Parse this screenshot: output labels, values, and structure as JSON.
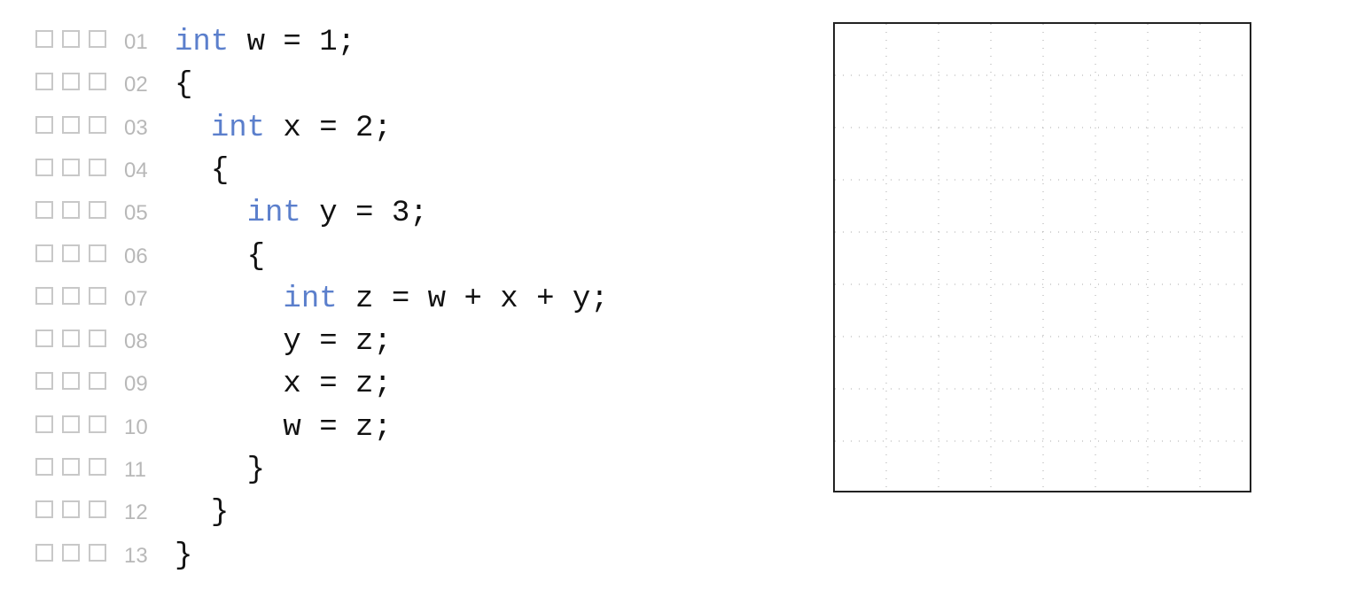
{
  "code": {
    "lines": [
      {
        "number": "01",
        "indent": "",
        "keyword": "int",
        "text": " w = 1;"
      },
      {
        "number": "02",
        "indent": "",
        "keyword": "",
        "text": "{"
      },
      {
        "number": "03",
        "indent": "  ",
        "keyword": "int",
        "text": " x = 2;"
      },
      {
        "number": "04",
        "indent": "  ",
        "keyword": "",
        "text": "{"
      },
      {
        "number": "05",
        "indent": "    ",
        "keyword": "int",
        "text": " y = 3;"
      },
      {
        "number": "06",
        "indent": "    ",
        "keyword": "",
        "text": "{"
      },
      {
        "number": "07",
        "indent": "      ",
        "keyword": "int",
        "text": " z = w + x + y;"
      },
      {
        "number": "08",
        "indent": "      ",
        "keyword": "",
        "text": "y = z;"
      },
      {
        "number": "09",
        "indent": "      ",
        "keyword": "",
        "text": "x = z;"
      },
      {
        "number": "10",
        "indent": "      ",
        "keyword": "",
        "text": "w = z;"
      },
      {
        "number": "11",
        "indent": "    ",
        "keyword": "",
        "text": "}"
      },
      {
        "number": "12",
        "indent": "  ",
        "keyword": "",
        "text": "}"
      },
      {
        "number": "13",
        "indent": "",
        "keyword": "",
        "text": "}"
      }
    ]
  },
  "checkboxes_per_line": 3,
  "colors": {
    "keyword": "#5b7fcc",
    "line_number": "#b8b8b8",
    "checkbox_border": "#c8c8c8",
    "code_text": "#111111",
    "grid_dots": "#a8a8a8"
  }
}
